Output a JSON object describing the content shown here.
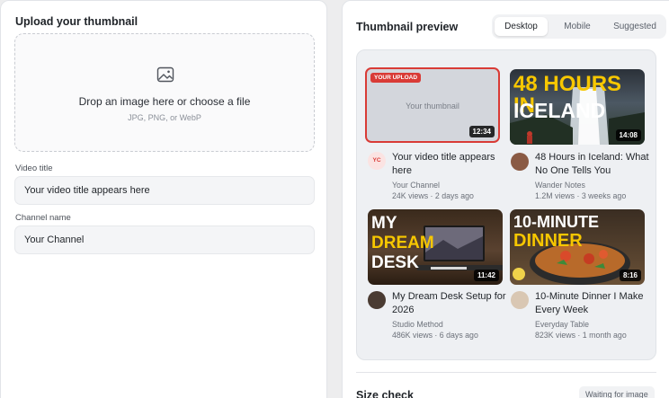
{
  "upload": {
    "heading": "Upload your thumbnail",
    "drop_title": "Drop an image here or choose a file",
    "drop_hint": "JPG, PNG, or WebP",
    "video_title_label": "Video title",
    "video_title_value": "Your video title appears here",
    "channel_name_label": "Channel name",
    "channel_name_value": "Your Channel"
  },
  "preview": {
    "heading": "Thumbnail preview",
    "tabs": [
      "Desktop",
      "Mobile",
      "Suggested"
    ],
    "active_tab": "Desktop",
    "videos": [
      {
        "tag": "YOUR UPLOAD",
        "placeholder": "Your thumbnail",
        "duration": "12:34",
        "title": "Your video title appears here",
        "channel_initials": "YC",
        "channel": "Your Channel",
        "stats": "24K views · 2 days ago"
      },
      {
        "thumb_text_1": "48 HOURS IN",
        "thumb_text_2": "ICELAND",
        "duration": "14:08",
        "title": "48 Hours in Iceland: What No One Tells You",
        "channel": "Wander Notes",
        "stats": "1.2M views · 3 weeks ago"
      },
      {
        "thumb_text_1": "MY",
        "thumb_text_2": "DREAM",
        "thumb_text_3": "DESK",
        "duration": "11:42",
        "title": "My Dream Desk Setup for 2026",
        "channel": "Studio Method",
        "stats": "486K views · 6 days ago"
      },
      {
        "thumb_text_1": "10-MINUTE",
        "thumb_text_2": "DINNER",
        "duration": "8:16",
        "title": "10-Minute Dinner I Make Every Week",
        "channel": "Everyday Table",
        "stats": "823K views · 1 month ago"
      }
    ]
  },
  "size_check": {
    "heading": "Size check",
    "status": "Waiting for image"
  },
  "colors": {
    "accent_red": "#d93b36",
    "thumb_yellow": "#f7c700"
  }
}
